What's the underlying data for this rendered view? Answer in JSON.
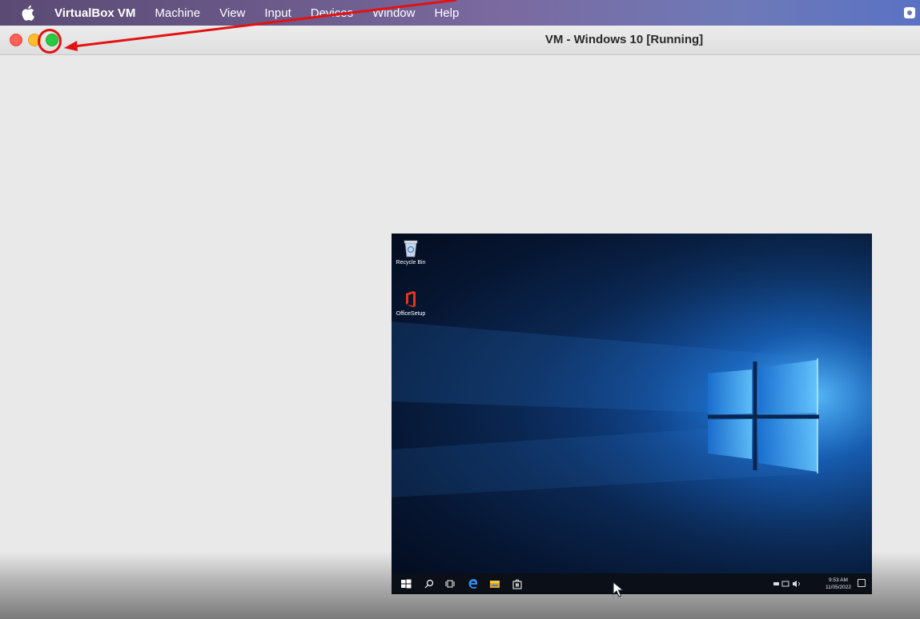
{
  "menubar": {
    "app_name": "VirtualBox VM",
    "items": [
      "Machine",
      "View",
      "Input",
      "Devices",
      "Window",
      "Help"
    ]
  },
  "window": {
    "title": "VM - Windows 10 [Running]"
  },
  "desktop": {
    "icons": [
      {
        "label": "Recycle Bin",
        "icon": "recycle-bin-icon"
      },
      {
        "label": "OfficeSetup",
        "icon": "office-icon"
      }
    ]
  },
  "taskbar": {
    "time": "9:53 AM",
    "date": "11/05/2022"
  },
  "colors": {
    "close": "#fe5f57",
    "minimize": "#febc2e",
    "zoom": "#28c840",
    "annotation": "#e21212"
  }
}
